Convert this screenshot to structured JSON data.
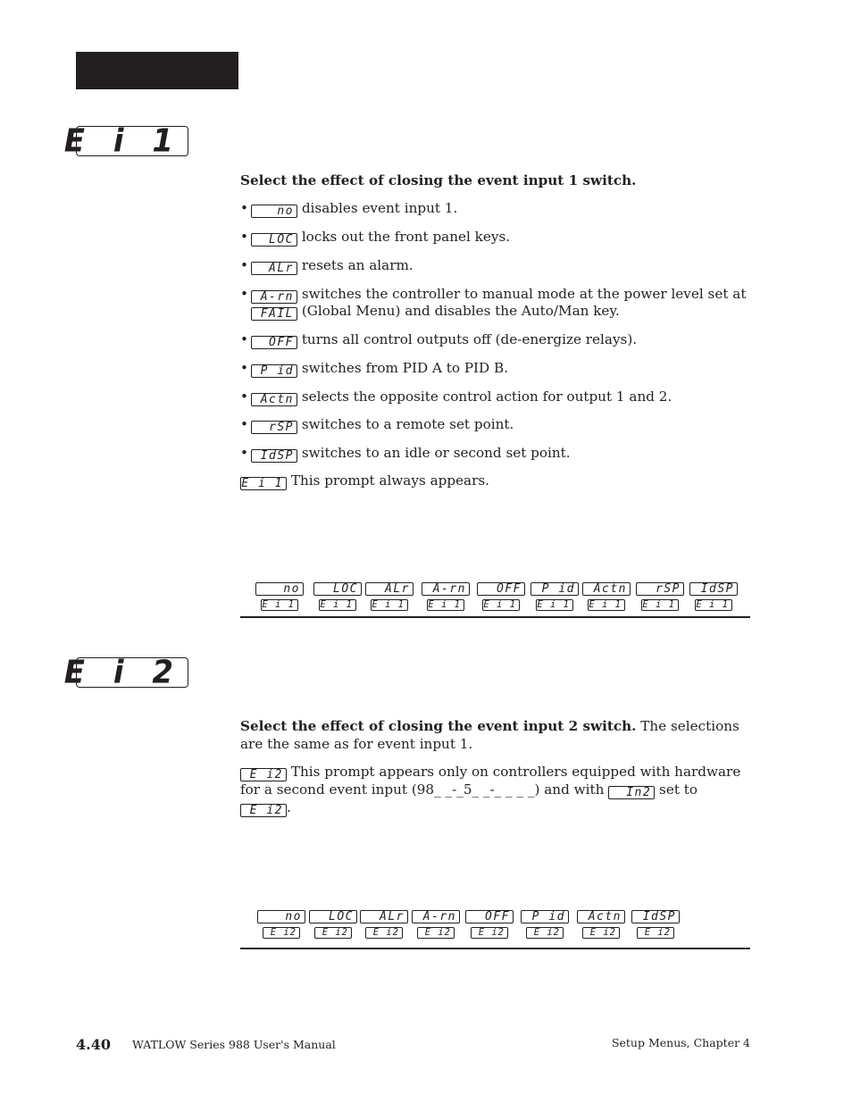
{
  "page": {
    "header_bar": "",
    "section1": {
      "display": "E i 1",
      "heading": "Select the effect of closing the event input 1 switch.",
      "options": [
        {
          "code": "  no",
          "text": "disables event input 1."
        },
        {
          "code": " LOC",
          "text": "locks out the front panel keys."
        },
        {
          "code": " ALr",
          "text": "resets an alarm."
        },
        {
          "code": "A-rn",
          "text": "switches the controller to manual mode at the power level set at",
          "extra_code": "FAIL",
          "extra_text": "(Global Menu) and disables the Auto/Man    key."
        },
        {
          "code": " OFF",
          "text": "turns all control outputs off (de-energize relays)."
        },
        {
          "code": " P id",
          "text": "switches from PID A to PID B."
        },
        {
          "code": "Actn",
          "text": "selects the opposite control action for output 1 and 2."
        },
        {
          "code": " rSP",
          "text": "switches to a remote set point."
        },
        {
          "code": "IdSP",
          "text": "switches to an idle or second set point."
        }
      ],
      "note_code": " E i 1",
      "note_text": "This prompt always appears.",
      "sequence": {
        "values": [
          "  no",
          " LOC",
          " ALr",
          "A-rn",
          " OFF",
          " P id",
          "Actn",
          " rSP",
          "IdSP"
        ],
        "prompt": "E i 1"
      }
    },
    "section2": {
      "display": "E i 2",
      "heading": "Select the effect of closing the event input 2 switch.",
      "heading_rest": "The selections are the same as for event input 1.",
      "note_code": " E i2",
      "note_text_1": "This prompt appears only on controllers equipped with hardware",
      "note_text_2": "for a second event input (98_ _-_5_ _-_ _ _ _) and with",
      "note_code_2": "In2",
      "note_text_3": "set to",
      "note_code_3": " E i2",
      "note_text_4": ".",
      "sequence": {
        "values": [
          "  no",
          " LOC",
          " ALr",
          "A-rn",
          " OFF",
          " P id",
          "Actn",
          "IdSP"
        ],
        "prompt": "E i2"
      }
    },
    "footer": {
      "page_number": "4.40",
      "manual_title": "WATLOW Series 988 User's Manual",
      "chapter": "Setup Menus, Chapter 4"
    }
  }
}
